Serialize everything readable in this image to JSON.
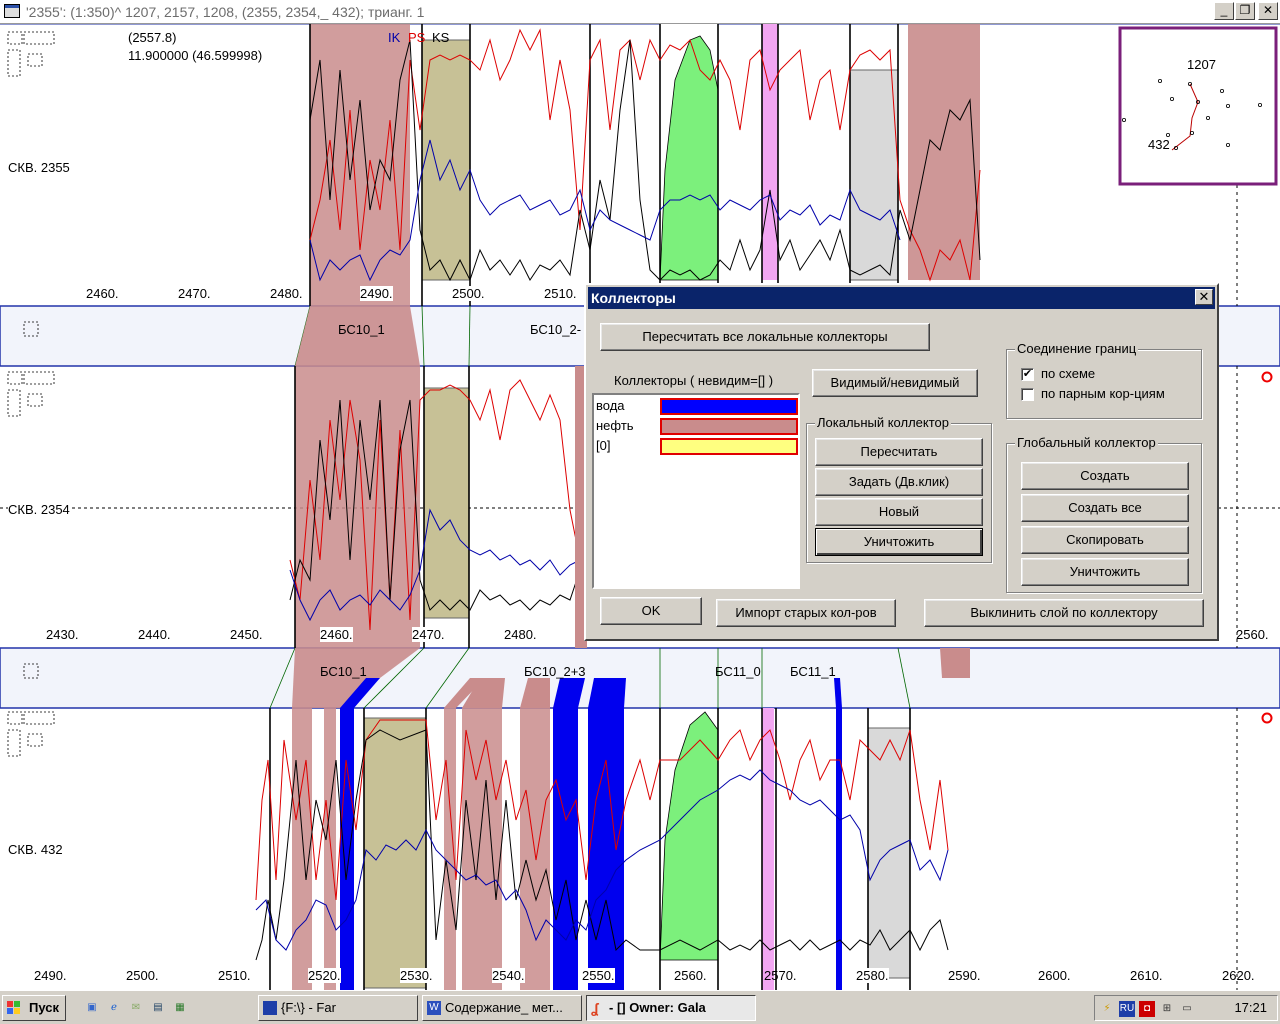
{
  "window": {
    "title": "'2355': (1:350)^ 1207, 2157, 1208, (2355, 2354,_ 432); трианг. 1",
    "min_glyph": "_",
    "max_glyph": "❐",
    "close_glyph": "✕"
  },
  "readout": {
    "line1": "(2557.8)",
    "line2": "11.900000 (46.599998)"
  },
  "curve_legend": [
    "IK",
    "PS",
    "KS"
  ],
  "wells": [
    {
      "name": "СКВ. 2355",
      "ticks": [
        "2460.",
        "2470.",
        "2480.",
        "2490.",
        "2500.",
        "2510."
      ]
    },
    {
      "name": "СКВ. 2354",
      "ticks": [
        "2430.",
        "2440.",
        "2450.",
        "2460.",
        "2470.",
        "2480.",
        "2560."
      ]
    },
    {
      "name": "СКВ. 432",
      "ticks": [
        "2490.",
        "2500.",
        "2510.",
        "2520.",
        "2530.",
        "2540.",
        "2550.",
        "2560.",
        "2570.",
        "2580.",
        "2590.",
        "2600.",
        "2610.",
        "2620."
      ]
    }
  ],
  "strat_labels_1": [
    "БС10_1",
    "БС10_2-"
  ],
  "strat_labels_2": [
    "БС10_1",
    "БС10_2+3",
    "БС11_0",
    "БС11_1"
  ],
  "minimap": {
    "label_top": "1207",
    "label_bottom": "432"
  },
  "dialog": {
    "title": "Коллекторы",
    "recalc_all": "Пересчитать все локальные коллекторы",
    "list_caption": "Коллекторы ( невидим=[] )",
    "visible_toggle": "Видимый/невидимый",
    "items": [
      {
        "name": "вода",
        "color": "#0000ff"
      },
      {
        "name": "нефть",
        "color": "#c98c8c"
      },
      {
        "name": "[0]",
        "color": "#ffff80"
      }
    ],
    "border_group": "Соединение границ",
    "by_scheme": "по схеме",
    "by_pairs": "по парным кор-циям",
    "local_group": "Локальный коллектор",
    "local_buttons": [
      "Пересчитать",
      "Задать (Дв.клик)",
      "Новый",
      "Уничтожить"
    ],
    "global_group": "Глобальный коллектор",
    "global_buttons": [
      "Создать",
      "Создать все",
      "Скопировать",
      "Уничтожить"
    ],
    "ok": "OK",
    "import_old": "Импорт старых кол-ров",
    "align_layer": "Выклинить слой по коллектору",
    "close_glyph": "✕",
    "check_mark": "✔"
  },
  "taskbar": {
    "start": "Пуск",
    "tasks": [
      "{F:\\} - Far",
      "Содержание_ мет...",
      "- [] Owner: Gala"
    ],
    "lang": "RU",
    "time": "17:21"
  }
}
